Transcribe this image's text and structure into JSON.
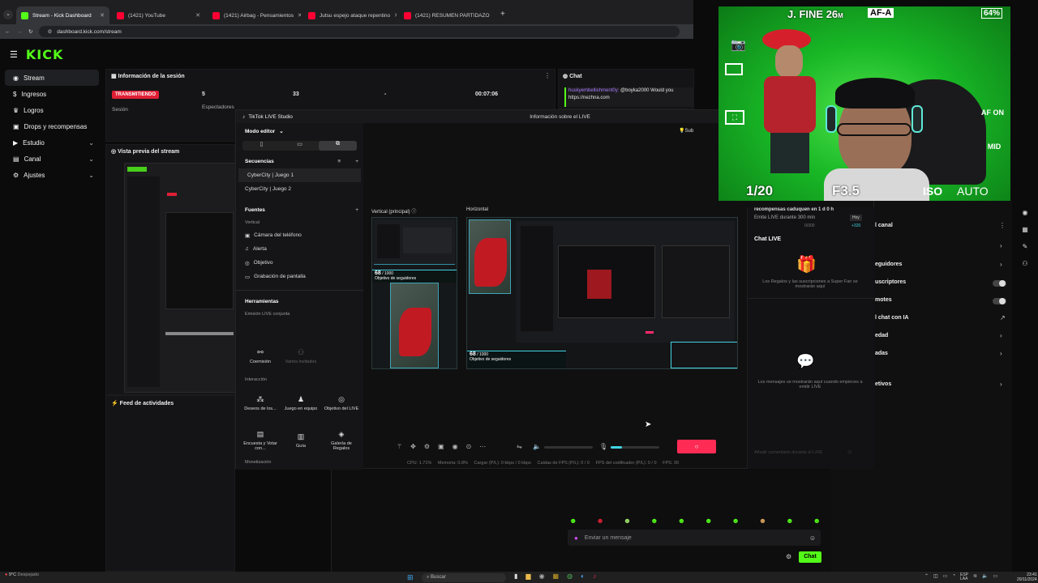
{
  "browser": {
    "tabs": [
      {
        "title": "Stream - Kick Dashboard",
        "active": true,
        "color": "#53fc18"
      },
      {
        "title": "(1421) YouTube",
        "active": false,
        "color": "#ff0033"
      },
      {
        "title": "(1421) Airbag - Pensamientos",
        "active": false,
        "color": "#ff0033"
      },
      {
        "title": "Jutsu espejo ataque repentino",
        "active": false,
        "color": "#ff0033"
      },
      {
        "title": "(1421) RESUMEN PARTIDAZO",
        "active": false,
        "color": "#ff0033"
      }
    ],
    "url": "dashboard.kick.com/stream"
  },
  "kick": {
    "logo": "KICK",
    "sidebar": [
      {
        "label": "Stream",
        "active": true,
        "icon": "broadcast-icon"
      },
      {
        "label": "Ingresos",
        "icon": "money-icon"
      },
      {
        "label": "Logros",
        "icon": "trophy-icon"
      },
      {
        "label": "Drops y recompensas",
        "icon": "gift-icon"
      },
      {
        "label": "Estudio",
        "icon": "video-icon",
        "expandable": true
      },
      {
        "label": "Canal",
        "icon": "channel-icon",
        "expandable": true
      },
      {
        "label": "Ajustes",
        "icon": "gear-icon",
        "expandable": true
      }
    ],
    "session": {
      "title": "Información de la sesión",
      "status": "TRANSMITIENDO",
      "session_label": "Sesión",
      "viewers": "5",
      "viewers_label": "Espectadores",
      "followers": "33",
      "dash": "-",
      "time": "00:07:06"
    },
    "preview_title": "Vista previa del stream",
    "feed_title": "Feed de actividades",
    "chat": {
      "title": "Chat",
      "msg_user": "huskyembellishment0y:",
      "msg_text": "@boyka2000 Would you",
      "msg_link": "https://nezhna.com",
      "input_placeholder": "Enviar un mensaje",
      "send_label": "Chat"
    },
    "right_panel": {
      "items": [
        "l canal",
        "eguidores",
        "uscriptores",
        "motes",
        "l chat con IA",
        "edad",
        "adas",
        "etivos"
      ]
    }
  },
  "tiktok": {
    "title": "TikTok LIVE Studio",
    "info_label": "Información sobre el LIVE",
    "mode": "Modo editor",
    "sequences_title": "Secuencias",
    "sequences": [
      "CyberCity | Juego 1",
      "CyberCity | Juego 2"
    ],
    "sources_title": "Fuentes",
    "sources_sub": "Vertical",
    "sources": [
      "Cámara del teléfono",
      "Alerta",
      "Objetivo",
      "Grabación de pantalla"
    ],
    "tools_title": "Herramientas",
    "joint_label": "Emisión LIVE conjunta",
    "tiles_joint": [
      "Coemisión",
      "Varios invitados"
    ],
    "interaction_label": "Interacción",
    "tiles_interaction": [
      "Deseos de los...",
      "Juego en equipo",
      "Objetivo del LIVE",
      "Encuesta y Votar con...",
      "Guía",
      "Galería de Regalos"
    ],
    "monetization_label": "Monetización",
    "vertical_label": "Vertical (principal)",
    "horizontal_label": "Horizontal",
    "goal_count": "68",
    "goal_total": "/ 1000",
    "goal_label": "Objetivo de seguidores",
    "stats": "CPU: 1.71%     Memoria: 0.8%     Cargar (P/L): 0 kbps / 0 kbps     Caídas de FPS (P/L): 0 / 0     FPS del codificador (P/L): 0 / 0     FPS: 30",
    "live_chat_title": "Chat LIVE",
    "gifts_text": "Los Regalos y las suscripciones a Super Fan se mostrarán aquí",
    "messages_text": "Los mensajes se mostrarán aquí cuando empieces a emitir LIVE",
    "reward_text": "recompensas caduquen en 1 d 0 h",
    "emit_text": "Emite LIVE durante 300 min",
    "emit_progress": "0/300",
    "emit_badge": "Hoy",
    "emit_reward": "+320",
    "comment_placeholder": "Añadir comentario durante el LIVE",
    "sub_label": "Sub"
  },
  "camera": {
    "shutter": "1/20",
    "aperture": "F3.5",
    "iso": "ISO",
    "iso_value": "AUTO",
    "battery": "64%",
    "overlay_name": "J. FINE",
    "overlay_num": "26",
    "overlay_unit": "M",
    "af_mode": "AF-A",
    "af_on": "AF ON",
    "mid": "MID"
  },
  "taskbar": {
    "search": "Buscar",
    "temp": "9°C",
    "weather": "Despejado",
    "lang": "ESP",
    "lang2": "LAA",
    "time": "23:41",
    "date": "20/11/2024"
  }
}
